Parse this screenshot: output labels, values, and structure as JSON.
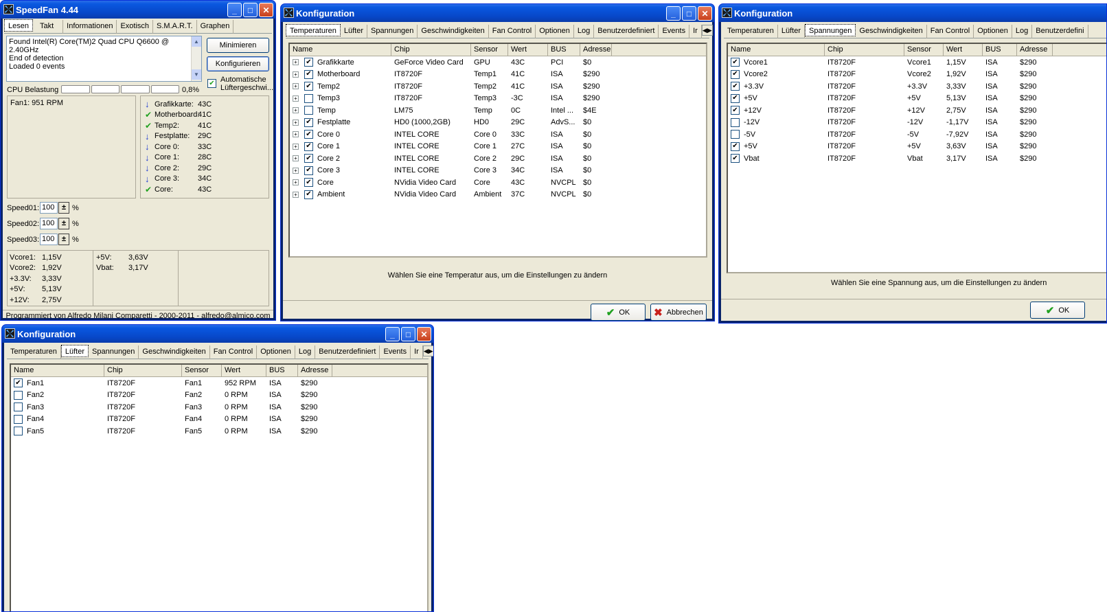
{
  "speedfan": {
    "title": "SpeedFan 4.44",
    "tabs": [
      "Lesen",
      "Takt",
      "Informationen",
      "Exotisch",
      "S.M.A.R.T.",
      "Graphen"
    ],
    "log_lines": [
      "Found Intel(R) Core(TM)2 Quad CPU Q6600 @ 2.40GHz",
      "End of detection",
      "Loaded 0 events"
    ],
    "minimize_label": "Minimieren",
    "configure_label": "Konfigurieren",
    "auto_fan_label_1": "Automatische",
    "auto_fan_label_2": "Lüftergeschwi...",
    "cpu_label": "CPU Belastung",
    "cpu_value": "0,8%",
    "cpu_load_percent": 0.8,
    "fan_text": "Fan1: 951 RPM",
    "temps": [
      {
        "icon": "down",
        "label": "Grafikkarte:",
        "value": "43C"
      },
      {
        "icon": "check",
        "label": "Motherboard:",
        "value": "41C"
      },
      {
        "icon": "check",
        "label": "Temp2:",
        "value": "41C"
      },
      {
        "icon": "down",
        "label": "Festplatte:",
        "value": "29C"
      },
      {
        "icon": "down",
        "label": "Core 0:",
        "value": "33C"
      },
      {
        "icon": "down",
        "label": "Core 1:",
        "value": "28C"
      },
      {
        "icon": "down",
        "label": "Core 2:",
        "value": "29C"
      },
      {
        "icon": "down",
        "label": "Core 3:",
        "value": "34C"
      },
      {
        "icon": "check",
        "label": "Core:",
        "value": "43C"
      }
    ],
    "speeds": [
      {
        "label": "Speed01:",
        "value": "100",
        "unit": "%"
      },
      {
        "label": "Speed02:",
        "value": "100",
        "unit": "%"
      },
      {
        "label": "Speed03:",
        "value": "100",
        "unit": "%"
      }
    ],
    "voltages_left": [
      {
        "label": "Vcore1:",
        "value": "1,15V"
      },
      {
        "label": "Vcore2:",
        "value": "1,92V"
      },
      {
        "label": "+3.3V:",
        "value": "3,33V"
      },
      {
        "label": "+5V:",
        "value": "5,13V"
      },
      {
        "label": "+12V:",
        "value": "2,75V"
      }
    ],
    "voltages_right": [
      {
        "label": "+5V:",
        "value": "3,63V"
      },
      {
        "label": "Vbat:",
        "value": "3,17V"
      }
    ],
    "footer": "Programmiert von Alfredo Milani Comparetti - 2000-2011 - alfredo@almico.com"
  },
  "config_temp": {
    "title": "Konfiguration",
    "tabs": [
      "Temperaturen",
      "Lüfter",
      "Spannungen",
      "Geschwindigkeiten",
      "Fan Control",
      "Optionen",
      "Log",
      "Benutzerdefiniert",
      "Events",
      "Ir"
    ],
    "columns": [
      "Name",
      "Chip",
      "Sensor",
      "Wert",
      "BUS",
      "Adresse"
    ],
    "rows": [
      {
        "checked": true,
        "name": "Grafikkarte",
        "chip": "GeForce Video Card",
        "sensor": "GPU",
        "value": "43C",
        "bus": "PCI",
        "addr": "$0"
      },
      {
        "checked": true,
        "name": "Motherboard",
        "chip": "IT8720F",
        "sensor": "Temp1",
        "value": "41C",
        "bus": "ISA",
        "addr": "$290"
      },
      {
        "checked": true,
        "name": "Temp2",
        "chip": "IT8720F",
        "sensor": "Temp2",
        "value": "41C",
        "bus": "ISA",
        "addr": "$290"
      },
      {
        "checked": false,
        "name": "Temp3",
        "chip": "IT8720F",
        "sensor": "Temp3",
        "value": "-3C",
        "bus": "ISA",
        "addr": "$290"
      },
      {
        "checked": false,
        "name": "Temp",
        "chip": "LM75",
        "sensor": "Temp",
        "value": "0C",
        "bus": "Intel ...",
        "addr": "$4E"
      },
      {
        "checked": true,
        "name": "Festplatte",
        "chip": "HD0 (1000,2GB)",
        "sensor": "HD0",
        "value": "29C",
        "bus": "AdvS...",
        "addr": "$0"
      },
      {
        "checked": true,
        "name": "Core 0",
        "chip": "INTEL CORE",
        "sensor": "Core 0",
        "value": "33C",
        "bus": "ISA",
        "addr": "$0"
      },
      {
        "checked": true,
        "name": "Core 1",
        "chip": "INTEL CORE",
        "sensor": "Core 1",
        "value": "27C",
        "bus": "ISA",
        "addr": "$0"
      },
      {
        "checked": true,
        "name": "Core 2",
        "chip": "INTEL CORE",
        "sensor": "Core 2",
        "value": "29C",
        "bus": "ISA",
        "addr": "$0"
      },
      {
        "checked": true,
        "name": "Core 3",
        "chip": "INTEL CORE",
        "sensor": "Core 3",
        "value": "34C",
        "bus": "ISA",
        "addr": "$0"
      },
      {
        "checked": true,
        "name": "Core",
        "chip": "NVidia Video Card",
        "sensor": "Core",
        "value": "43C",
        "bus": "NVCPL",
        "addr": "$0"
      },
      {
        "checked": true,
        "name": "Ambient",
        "chip": "NVidia Video Card",
        "sensor": "Ambient",
        "value": "37C",
        "bus": "NVCPL",
        "addr": "$0"
      }
    ],
    "hint": "Wählen Sie eine Temperatur aus, um die Einstellungen zu ändern",
    "ok_label": "OK",
    "cancel_label": "Abbrechen"
  },
  "config_volt": {
    "title": "Konfiguration",
    "tabs": [
      "Temperaturen",
      "Lüfter",
      "Spannungen",
      "Geschwindigkeiten",
      "Fan Control",
      "Optionen",
      "Log",
      "Benutzerdefini"
    ],
    "columns": [
      "Name",
      "Chip",
      "Sensor",
      "Wert",
      "BUS",
      "Adresse"
    ],
    "rows": [
      {
        "checked": true,
        "name": "Vcore1",
        "chip": "IT8720F",
        "sensor": "Vcore1",
        "value": "1,15V",
        "bus": "ISA",
        "addr": "$290"
      },
      {
        "checked": true,
        "name": "Vcore2",
        "chip": "IT8720F",
        "sensor": "Vcore2",
        "value": "1,92V",
        "bus": "ISA",
        "addr": "$290"
      },
      {
        "checked": true,
        "name": "+3.3V",
        "chip": "IT8720F",
        "sensor": "+3.3V",
        "value": "3,33V",
        "bus": "ISA",
        "addr": "$290"
      },
      {
        "checked": true,
        "name": "+5V",
        "chip": "IT8720F",
        "sensor": "+5V",
        "value": "5,13V",
        "bus": "ISA",
        "addr": "$290"
      },
      {
        "checked": true,
        "name": "+12V",
        "chip": "IT8720F",
        "sensor": "+12V",
        "value": "2,75V",
        "bus": "ISA",
        "addr": "$290"
      },
      {
        "checked": false,
        "name": "-12V",
        "chip": "IT8720F",
        "sensor": "-12V",
        "value": "-1,17V",
        "bus": "ISA",
        "addr": "$290"
      },
      {
        "checked": false,
        "name": "-5V",
        "chip": "IT8720F",
        "sensor": "-5V",
        "value": "-7,92V",
        "bus": "ISA",
        "addr": "$290"
      },
      {
        "checked": true,
        "name": "+5V",
        "chip": "IT8720F",
        "sensor": "+5V",
        "value": "3,63V",
        "bus": "ISA",
        "addr": "$290"
      },
      {
        "checked": true,
        "name": "Vbat",
        "chip": "IT8720F",
        "sensor": "Vbat",
        "value": "3,17V",
        "bus": "ISA",
        "addr": "$290"
      }
    ],
    "hint": "Wählen Sie eine Spannung aus, um die Einstellungen zu ändern",
    "ok_label": "OK"
  },
  "config_fan": {
    "title": "Konfiguration",
    "tabs": [
      "Temperaturen",
      "Lüfter",
      "Spannungen",
      "Geschwindigkeiten",
      "Fan Control",
      "Optionen",
      "Log",
      "Benutzerdefiniert",
      "Events",
      "Ir"
    ],
    "columns": [
      "Name",
      "Chip",
      "Sensor",
      "Wert",
      "BUS",
      "Adresse"
    ],
    "rows": [
      {
        "checked": true,
        "name": "Fan1",
        "chip": "IT8720F",
        "sensor": "Fan1",
        "value": "952 RPM",
        "bus": "ISA",
        "addr": "$290"
      },
      {
        "checked": false,
        "name": "Fan2",
        "chip": "IT8720F",
        "sensor": "Fan2",
        "value": "0 RPM",
        "bus": "ISA",
        "addr": "$290"
      },
      {
        "checked": false,
        "name": "Fan3",
        "chip": "IT8720F",
        "sensor": "Fan3",
        "value": "0 RPM",
        "bus": "ISA",
        "addr": "$290"
      },
      {
        "checked": false,
        "name": "Fan4",
        "chip": "IT8720F",
        "sensor": "Fan4",
        "value": "0 RPM",
        "bus": "ISA",
        "addr": "$290"
      },
      {
        "checked": false,
        "name": "Fan5",
        "chip": "IT8720F",
        "sensor": "Fan5",
        "value": "0 RPM",
        "bus": "ISA",
        "addr": "$290"
      }
    ]
  }
}
